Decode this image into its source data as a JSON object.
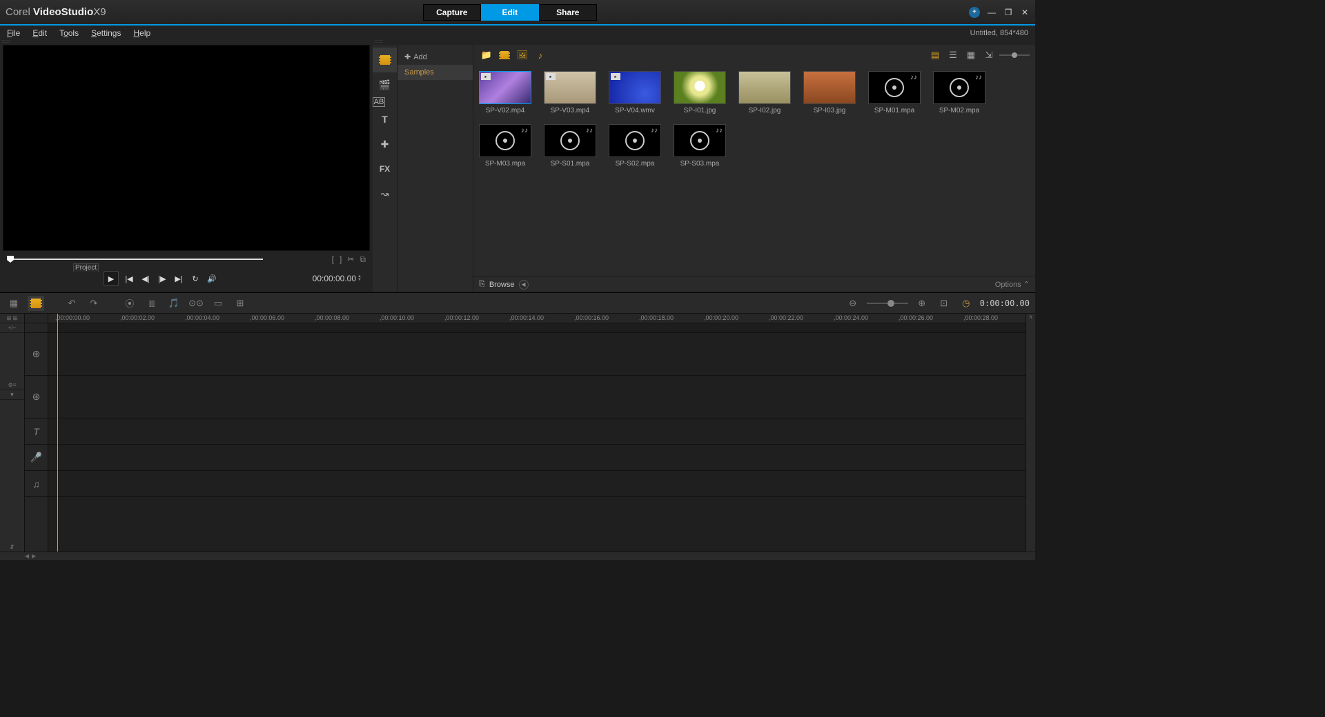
{
  "app": {
    "brand_pre": "Corel",
    "brand_main": "VideoStudio",
    "brand_ver": "X9"
  },
  "tabs": {
    "capture": "Capture",
    "edit": "Edit",
    "share": "Share"
  },
  "menu": {
    "file": "File",
    "edit": "Edit",
    "tools": "Tools",
    "settings": "Settings",
    "help": "Help"
  },
  "project_info": "Untitled, 854*480",
  "preview": {
    "project_label": "Project",
    "timecode": "00:00:00.00"
  },
  "library": {
    "add_label": "Add",
    "tree": [
      "Samples"
    ],
    "browse": "Browse",
    "options": "Options",
    "items": [
      {
        "name": "SP-V02.mp4",
        "kind": "video",
        "bg": "linear-gradient(135deg,#5a3fa0,#b080e0,#3a2a70)",
        "sel": true,
        "badge": "▸"
      },
      {
        "name": "SP-V03.mp4",
        "kind": "video",
        "bg": "linear-gradient(#cfc3a8,#a89878)",
        "badge": "▸"
      },
      {
        "name": "SP-V04.wmv",
        "kind": "video",
        "bg": "radial-gradient(circle at 70% 70%,#3a5ae0,#1020a0)",
        "badge": "▸"
      },
      {
        "name": "SP-I01.jpg",
        "kind": "image",
        "bg": "radial-gradient(circle at 50% 45%,#fff 0 16%,#e8e890 18% 30%,#5a8020 60%)"
      },
      {
        "name": "SP-I02.jpg",
        "kind": "image",
        "bg": "linear-gradient(#c8c098,#989060)"
      },
      {
        "name": "SP-I03.jpg",
        "kind": "image",
        "bg": "linear-gradient(#c87040,#8a4820)"
      },
      {
        "name": "SP-M01.mpa",
        "kind": "audio"
      },
      {
        "name": "SP-M02.mpa",
        "kind": "audio"
      },
      {
        "name": "SP-M03.mpa",
        "kind": "audio"
      },
      {
        "name": "SP-S01.mpa",
        "kind": "audio"
      },
      {
        "name": "SP-S02.mpa",
        "kind": "audio"
      },
      {
        "name": "SP-S03.mpa",
        "kind": "audio"
      }
    ]
  },
  "timeline": {
    "timecode": "0:00:00.00",
    "marks": [
      ",00:00:00.00",
      ",00:00:02.00",
      ",00:00:04.00",
      ",00:00:06.00",
      ",00:00:08.00",
      ",00:00:10.00",
      ",00:00:12.00",
      ",00:00:14.00",
      ",00:00:16.00",
      ",00:00:18.00",
      ",00:00:20.00",
      ",00:00:22.00",
      ",00:00:24.00",
      ",00:00:26.00",
      ",00:00:28.00"
    ]
  }
}
